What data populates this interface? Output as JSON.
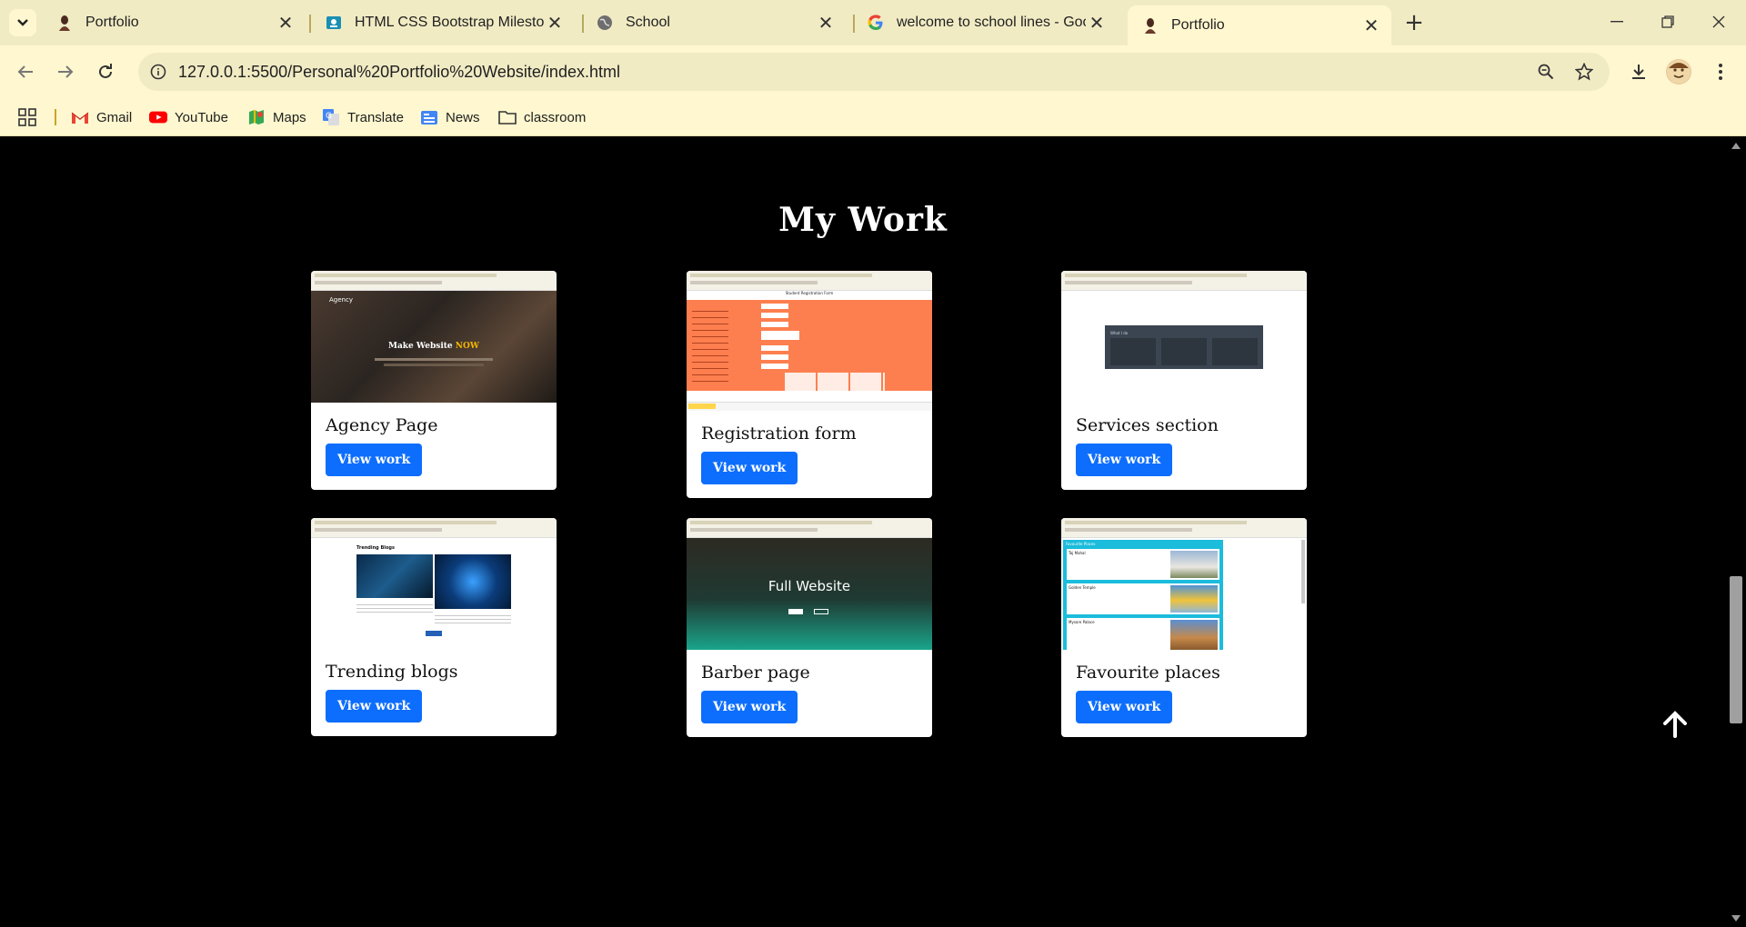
{
  "browser": {
    "tabs": [
      {
        "title": "Portfolio",
        "active": false
      },
      {
        "title": "HTML CSS Bootstrap Milestone",
        "active": false
      },
      {
        "title": "School",
        "active": false
      },
      {
        "title": "welcome to school lines - Goog",
        "active": false
      },
      {
        "title": "Portfolio",
        "active": true
      }
    ],
    "url": "127.0.0.1:5500/Personal%20Portfolio%20Website/index.html",
    "bookmarks": [
      {
        "label": "Gmail",
        "icon": "gmail-icon"
      },
      {
        "label": "YouTube",
        "icon": "youtube-icon"
      },
      {
        "label": "Maps",
        "icon": "maps-icon"
      },
      {
        "label": "Translate",
        "icon": "translate-icon"
      },
      {
        "label": "News",
        "icon": "news-icon"
      },
      {
        "label": "classroom",
        "icon": "folder-icon"
      }
    ]
  },
  "page": {
    "section_title": "My Work",
    "projects": [
      {
        "title": "Agency Page",
        "button": "View work",
        "thumb_heading": "Make Website",
        "thumb_accent": "NOW",
        "thumb_brand": "Agency"
      },
      {
        "title": "Registration form",
        "button": "View work",
        "thumb_heading": "Student Registration Form"
      },
      {
        "title": "Services section",
        "button": "View work",
        "thumb_heading": "What I do"
      },
      {
        "title": "Trending blogs",
        "button": "View work",
        "thumb_heading": "Trending Blogs"
      },
      {
        "title": "Barber page",
        "button": "View work",
        "thumb_heading": "Full Website"
      },
      {
        "title": "Favourite places",
        "button": "View work",
        "thumb_heading": "Favourite Places",
        "thumb_items": [
          "Taj Mahal",
          "Golden Temple",
          "Mysore Palace"
        ]
      }
    ]
  },
  "colors": {
    "accent": "#0d6efd",
    "tab_strip": "#f1ebc4",
    "toolbar": "#fff7cf",
    "page_bg": "#000000"
  }
}
